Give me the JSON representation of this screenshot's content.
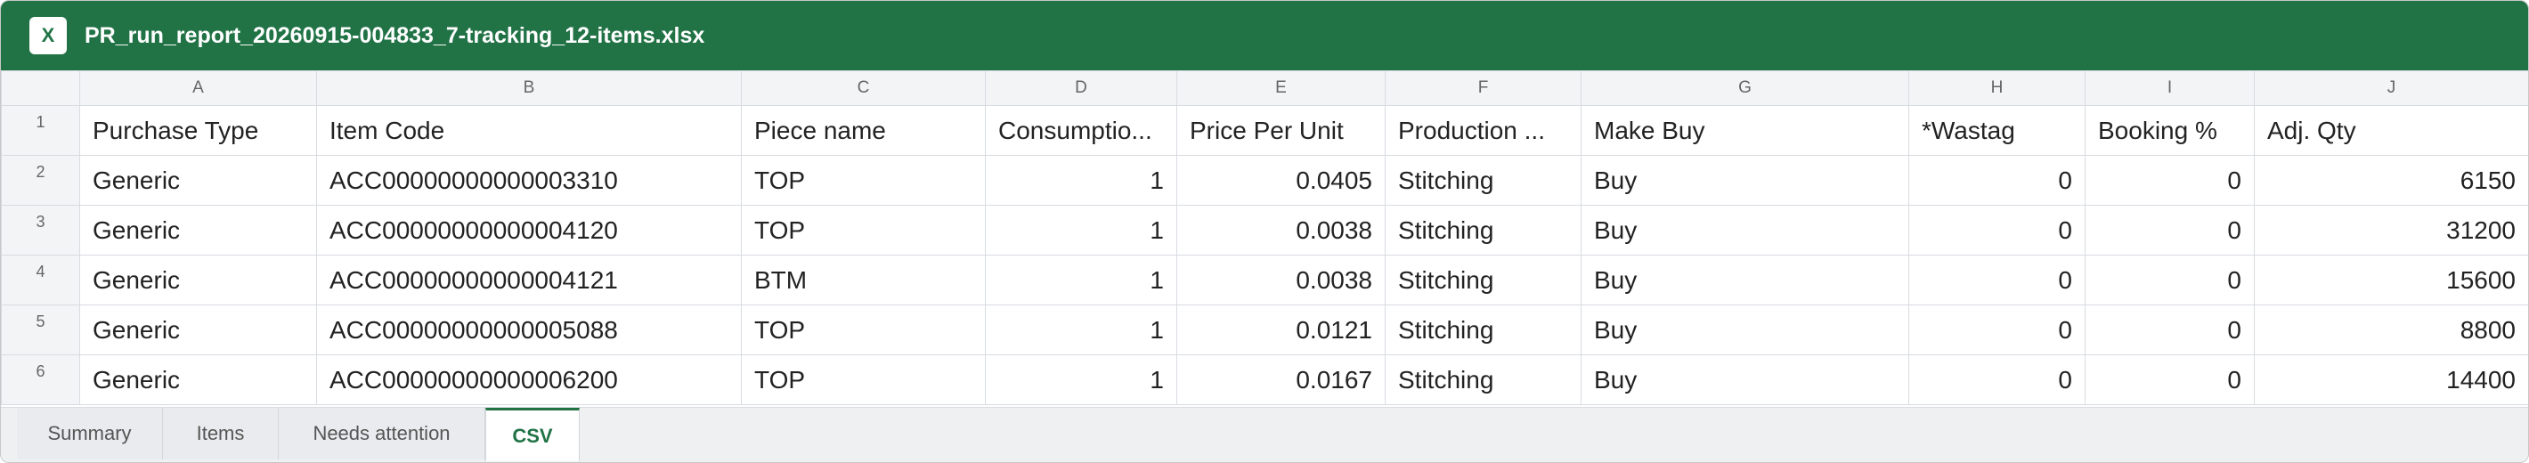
{
  "window": {
    "app_icon_label": "X",
    "title": "PR_run_report_20260915-004833_7-tracking_12-items.xlsx"
  },
  "colors": {
    "brand": "#217346",
    "header_bg": "#f3f4f6",
    "grid_line": "#d8dbe0"
  },
  "columns": [
    "A",
    "B",
    "C",
    "D",
    "E",
    "F",
    "G",
    "H",
    "I",
    "J"
  ],
  "row_numbers": [
    "1",
    "2",
    "3",
    "4",
    "5",
    "6"
  ],
  "header_row": [
    "Purchase Type",
    "Item Code",
    "Piece name",
    "Consumptio...",
    "Price Per Unit",
    "Production ...",
    "Make Buy",
    "*Wastag",
    "Booking %",
    "Adj. Qty"
  ],
  "rows": [
    [
      "Generic",
      "ACC00000000000003310",
      "TOP",
      "1",
      "0.0405",
      "Stitching",
      "Buy",
      "0",
      "0",
      "6150"
    ],
    [
      "Generic",
      "ACC00000000000004120",
      "TOP",
      "1",
      "0.0038",
      "Stitching",
      "Buy",
      "0",
      "0",
      "31200"
    ],
    [
      "Generic",
      "ACC00000000000004121",
      "BTM",
      "1",
      "0.0038",
      "Stitching",
      "Buy",
      "0",
      "0",
      "15600"
    ],
    [
      "Generic",
      "ACC00000000000005088",
      "TOP",
      "1",
      "0.0121",
      "Stitching",
      "Buy",
      "0",
      "0",
      "8800"
    ],
    [
      "Generic",
      "ACC00000000000006200",
      "TOP",
      "1",
      "0.0167",
      "Stitching",
      "Buy",
      "0",
      "0",
      "14400"
    ]
  ],
  "sheet_tabs": [
    {
      "label": "Summary",
      "active": false
    },
    {
      "label": "Items",
      "active": false
    },
    {
      "label": "Needs attention",
      "active": false
    },
    {
      "label": "CSV",
      "active": true
    }
  ]
}
